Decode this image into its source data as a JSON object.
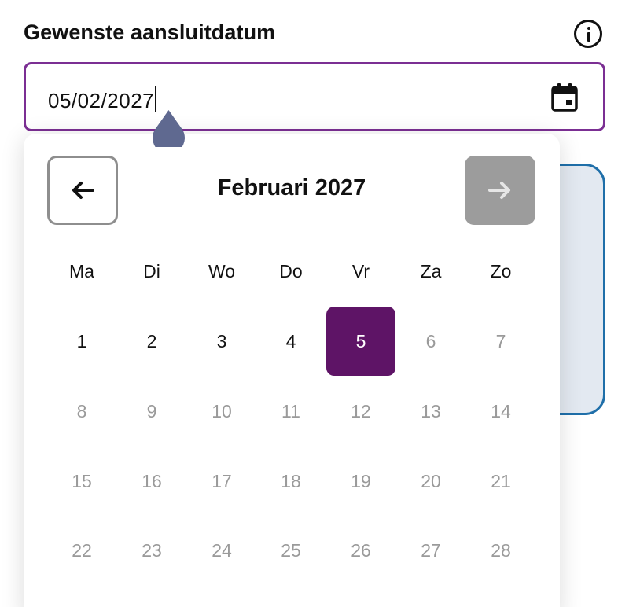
{
  "field": {
    "label": "Gewenste aansluitdatum",
    "value": "05/02/2027"
  },
  "calendar": {
    "month_title": "Februari 2027",
    "weekdays": [
      "Ma",
      "Di",
      "Wo",
      "Do",
      "Vr",
      "Za",
      "Zo"
    ],
    "weeks": [
      [
        "1",
        "2",
        "3",
        "4",
        "5",
        "6",
        "7"
      ],
      [
        "8",
        "9",
        "10",
        "11",
        "12",
        "13",
        "14"
      ],
      [
        "15",
        "16",
        "17",
        "18",
        "19",
        "20",
        "21"
      ],
      [
        "22",
        "23",
        "24",
        "25",
        "26",
        "27",
        "28"
      ]
    ],
    "selected_day": "5",
    "enabled_days": [
      "1",
      "2",
      "3",
      "4",
      "5"
    ],
    "prev_enabled": true,
    "next_enabled": false
  },
  "colors": {
    "accent": "#7b2f93",
    "selected": "#5e1466",
    "disabled_text": "#9a9a9a",
    "caret_handle": "#5f6990",
    "card_border": "#1f6fa9"
  },
  "icons": {
    "info": "info-icon",
    "calendar": "calendar-icon",
    "prev": "arrow-left-icon",
    "next": "arrow-right-icon"
  }
}
